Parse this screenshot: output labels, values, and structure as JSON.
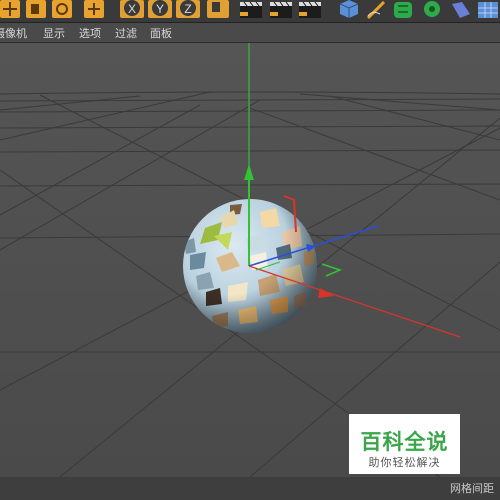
{
  "toolbar": {
    "buttons": [
      {
        "name": "move-tool-icon",
        "icon": "move-arrows"
      },
      {
        "name": "scale-tool-icon",
        "icon": "scale-box"
      },
      {
        "name": "rotate-tool-icon",
        "icon": "rotate-arrows"
      },
      {
        "name": "add-tool-icon",
        "icon": "plus-cross"
      },
      {
        "name": "x-axis-lock-icon",
        "icon": "X"
      },
      {
        "name": "y-axis-lock-icon",
        "icon": "Y"
      },
      {
        "name": "z-axis-lock-icon",
        "icon": "Z"
      },
      {
        "name": "coordinate-system-icon",
        "icon": "world-coords"
      },
      {
        "name": "render-view-icon",
        "icon": "clapper"
      },
      {
        "name": "render-picture-viewer-icon",
        "icon": "clapper-arrow"
      },
      {
        "name": "render-settings-icon",
        "icon": "clapper-gear"
      },
      {
        "name": "cube-object-icon",
        "icon": "cube"
      },
      {
        "name": "pen-spline-icon",
        "icon": "pen"
      },
      {
        "name": "subdivision-surface-icon",
        "icon": "green-mesh"
      },
      {
        "name": "array-object-icon",
        "icon": "green-gear"
      },
      {
        "name": "deformer-icon",
        "icon": "blue-bend"
      },
      {
        "name": "floor-object-icon",
        "icon": "blue-grid"
      }
    ]
  },
  "menu": {
    "items": [
      "摄像机",
      "显示",
      "选项",
      "过滤",
      "面板"
    ]
  },
  "status": {
    "grid_spacing_label": "网格间距"
  },
  "watermark": {
    "title": "百科全说",
    "subtitle": "助你轻松解决"
  },
  "colors": {
    "x_axis": "#d9342b",
    "y_axis": "#34c234",
    "z_axis": "#2b4fd9",
    "viewport_bg": "#4d4d4d",
    "watermark_green": "#3aa64a"
  }
}
